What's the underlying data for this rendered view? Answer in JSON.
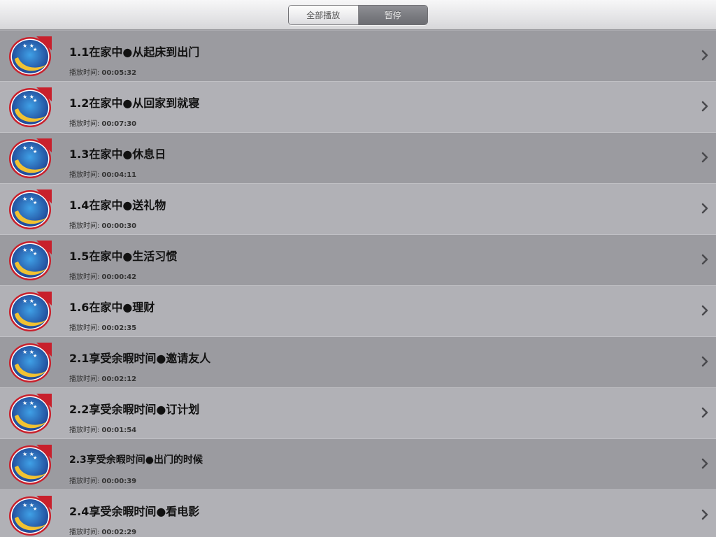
{
  "navbar": {
    "segments": [
      {
        "label": "全部播放",
        "selected": false
      },
      {
        "label": "暂停",
        "selected": true
      }
    ]
  },
  "list": {
    "time_label": "播放时间:",
    "items": [
      {
        "title": "1.1在家中●从起床到出门",
        "time": "00:05:32"
      },
      {
        "title": "1.2在家中●从回家到就寝",
        "time": "00:07:30"
      },
      {
        "title": "1.3在家中●休息日",
        "time": "00:04:11"
      },
      {
        "title": "1.4在家中●送礼物",
        "time": "00:00:30"
      },
      {
        "title": "1.5在家中●生活习惯",
        "time": "00:00:42"
      },
      {
        "title": "1.6在家中●理财",
        "time": "00:02:35"
      },
      {
        "title": "2.1享受余暇时间●邀请友人",
        "time": "00:02:12"
      },
      {
        "title": "2.2享受余暇时间●订计划",
        "time": "00:01:54"
      },
      {
        "title": "2.3享受余暇时间●出门的时候",
        "time": "00:00:39"
      },
      {
        "title": "2.4享受余暇时间●看电影",
        "time": "00:02:29"
      }
    ]
  },
  "icons": {
    "thumbnail": "moon-stars-logo-icon",
    "disclosure": "chevron-right-icon"
  },
  "colors": {
    "row_dark": "#9b9ba0",
    "row_light": "#b1b1b6",
    "logo_red": "#c8202c",
    "logo_blue": "#2f5aa8",
    "logo_yellow": "#f1c232"
  }
}
